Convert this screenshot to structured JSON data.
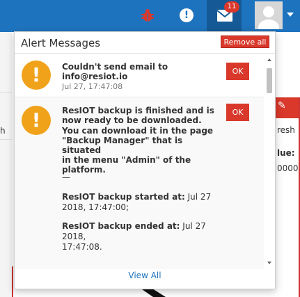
{
  "navbar": {
    "notification_badge": "11",
    "alert_icon_glyph": "!",
    "icons": [
      "bug-icon",
      "alert-icon",
      "envelope-icon",
      "user-avatar",
      "caret-down-icon"
    ],
    "colors": {
      "bar": "#1e73be",
      "active_tab": "#155a96",
      "badge": "#d9382b"
    }
  },
  "panel": {
    "title": "Alert Messages",
    "remove_all_label": "Remove all",
    "view_all_label": "View All",
    "ok_label": "OK",
    "messages": [
      {
        "icon": "warning-icon",
        "title_line1": "Couldn't send email to",
        "title_line2": "info@resiot.io",
        "time": "Jul 27, 17:47:08"
      },
      {
        "icon": "warning-icon",
        "title_line1": "ResIOT backup is finished and is",
        "title_line2": "now ready to be downloaded.",
        "body_line1": "You can download it in the page",
        "body_line2": "\"Backup Manager\" that is situated",
        "body_line3": "in the menu \"Admin\" of the",
        "body_line4": "platform.",
        "separator": "—",
        "started_label": "ResIOT backup started at:",
        "started_value": "Jul 27",
        "started_value2": "2018, 17:47:00;",
        "ended_label": "ResIOT backup ended at:",
        "ended_value": "Jul 27 2018,",
        "ended_value2": "17:47:08."
      }
    ],
    "colors": {
      "warning": "#f0a21a",
      "danger": "#d9382b",
      "link": "#1e73be"
    }
  },
  "background": {
    "left_char": "h",
    "right_text1": "resh",
    "right_text2": "lue:",
    "right_text3": "0000"
  }
}
